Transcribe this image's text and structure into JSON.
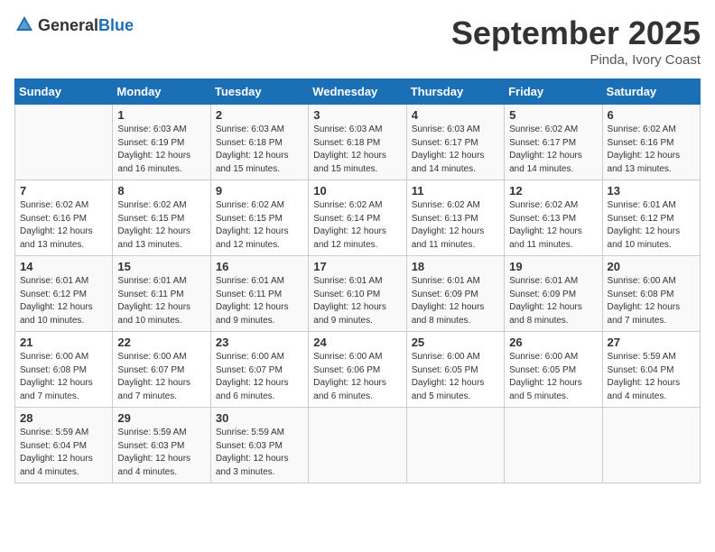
{
  "header": {
    "logo_general": "General",
    "logo_blue": "Blue",
    "month_year": "September 2025",
    "location": "Pinda, Ivory Coast"
  },
  "days_of_week": [
    "Sunday",
    "Monday",
    "Tuesday",
    "Wednesday",
    "Thursday",
    "Friday",
    "Saturday"
  ],
  "weeks": [
    [
      {
        "day": "",
        "info": ""
      },
      {
        "day": "1",
        "info": "Sunrise: 6:03 AM\nSunset: 6:19 PM\nDaylight: 12 hours\nand 16 minutes."
      },
      {
        "day": "2",
        "info": "Sunrise: 6:03 AM\nSunset: 6:18 PM\nDaylight: 12 hours\nand 15 minutes."
      },
      {
        "day": "3",
        "info": "Sunrise: 6:03 AM\nSunset: 6:18 PM\nDaylight: 12 hours\nand 15 minutes."
      },
      {
        "day": "4",
        "info": "Sunrise: 6:03 AM\nSunset: 6:17 PM\nDaylight: 12 hours\nand 14 minutes."
      },
      {
        "day": "5",
        "info": "Sunrise: 6:02 AM\nSunset: 6:17 PM\nDaylight: 12 hours\nand 14 minutes."
      },
      {
        "day": "6",
        "info": "Sunrise: 6:02 AM\nSunset: 6:16 PM\nDaylight: 12 hours\nand 13 minutes."
      }
    ],
    [
      {
        "day": "7",
        "info": "Sunrise: 6:02 AM\nSunset: 6:16 PM\nDaylight: 12 hours\nand 13 minutes."
      },
      {
        "day": "8",
        "info": "Sunrise: 6:02 AM\nSunset: 6:15 PM\nDaylight: 12 hours\nand 13 minutes."
      },
      {
        "day": "9",
        "info": "Sunrise: 6:02 AM\nSunset: 6:15 PM\nDaylight: 12 hours\nand 12 minutes."
      },
      {
        "day": "10",
        "info": "Sunrise: 6:02 AM\nSunset: 6:14 PM\nDaylight: 12 hours\nand 12 minutes."
      },
      {
        "day": "11",
        "info": "Sunrise: 6:02 AM\nSunset: 6:13 PM\nDaylight: 12 hours\nand 11 minutes."
      },
      {
        "day": "12",
        "info": "Sunrise: 6:02 AM\nSunset: 6:13 PM\nDaylight: 12 hours\nand 11 minutes."
      },
      {
        "day": "13",
        "info": "Sunrise: 6:01 AM\nSunset: 6:12 PM\nDaylight: 12 hours\nand 10 minutes."
      }
    ],
    [
      {
        "day": "14",
        "info": "Sunrise: 6:01 AM\nSunset: 6:12 PM\nDaylight: 12 hours\nand 10 minutes."
      },
      {
        "day": "15",
        "info": "Sunrise: 6:01 AM\nSunset: 6:11 PM\nDaylight: 12 hours\nand 10 minutes."
      },
      {
        "day": "16",
        "info": "Sunrise: 6:01 AM\nSunset: 6:11 PM\nDaylight: 12 hours\nand 9 minutes."
      },
      {
        "day": "17",
        "info": "Sunrise: 6:01 AM\nSunset: 6:10 PM\nDaylight: 12 hours\nand 9 minutes."
      },
      {
        "day": "18",
        "info": "Sunrise: 6:01 AM\nSunset: 6:09 PM\nDaylight: 12 hours\nand 8 minutes."
      },
      {
        "day": "19",
        "info": "Sunrise: 6:01 AM\nSunset: 6:09 PM\nDaylight: 12 hours\nand 8 minutes."
      },
      {
        "day": "20",
        "info": "Sunrise: 6:00 AM\nSunset: 6:08 PM\nDaylight: 12 hours\nand 7 minutes."
      }
    ],
    [
      {
        "day": "21",
        "info": "Sunrise: 6:00 AM\nSunset: 6:08 PM\nDaylight: 12 hours\nand 7 minutes."
      },
      {
        "day": "22",
        "info": "Sunrise: 6:00 AM\nSunset: 6:07 PM\nDaylight: 12 hours\nand 7 minutes."
      },
      {
        "day": "23",
        "info": "Sunrise: 6:00 AM\nSunset: 6:07 PM\nDaylight: 12 hours\nand 6 minutes."
      },
      {
        "day": "24",
        "info": "Sunrise: 6:00 AM\nSunset: 6:06 PM\nDaylight: 12 hours\nand 6 minutes."
      },
      {
        "day": "25",
        "info": "Sunrise: 6:00 AM\nSunset: 6:05 PM\nDaylight: 12 hours\nand 5 minutes."
      },
      {
        "day": "26",
        "info": "Sunrise: 6:00 AM\nSunset: 6:05 PM\nDaylight: 12 hours\nand 5 minutes."
      },
      {
        "day": "27",
        "info": "Sunrise: 5:59 AM\nSunset: 6:04 PM\nDaylight: 12 hours\nand 4 minutes."
      }
    ],
    [
      {
        "day": "28",
        "info": "Sunrise: 5:59 AM\nSunset: 6:04 PM\nDaylight: 12 hours\nand 4 minutes."
      },
      {
        "day": "29",
        "info": "Sunrise: 5:59 AM\nSunset: 6:03 PM\nDaylight: 12 hours\nand 4 minutes."
      },
      {
        "day": "30",
        "info": "Sunrise: 5:59 AM\nSunset: 6:03 PM\nDaylight: 12 hours\nand 3 minutes."
      },
      {
        "day": "",
        "info": ""
      },
      {
        "day": "",
        "info": ""
      },
      {
        "day": "",
        "info": ""
      },
      {
        "day": "",
        "info": ""
      }
    ]
  ]
}
